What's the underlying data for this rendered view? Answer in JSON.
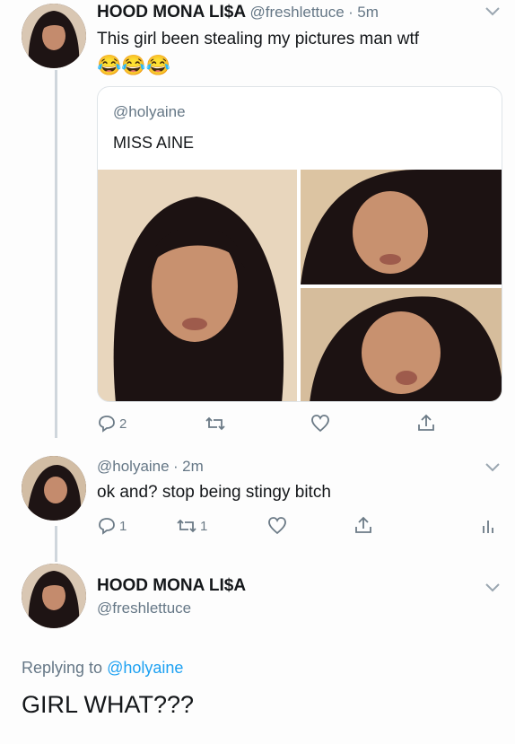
{
  "tweet1": {
    "display_name": "HOOD MONA LI$A",
    "handle": "@freshlettuce",
    "time": "5m",
    "text": "This girl been stealing my pictures man wtf",
    "emoji": "😂😂😂",
    "quote": {
      "handle": "@holyaine",
      "text": "MISS AINE"
    },
    "actions": {
      "reply_count": "2",
      "retweet_count": "",
      "like_count": ""
    }
  },
  "tweet2": {
    "handle": "@holyaine",
    "time": "2m",
    "text": "ok and? stop being stingy bitch",
    "actions": {
      "reply_count": "1",
      "retweet_count": "1",
      "like_count": ""
    }
  },
  "tweet3": {
    "display_name": "HOOD MONA LI$A",
    "handle": "@freshlettuce",
    "replying_prefix": "Replying to",
    "replying_to": "@holyaine",
    "text": "GIRL WHAT???"
  },
  "colors": {
    "link": "#1da1f2",
    "muted": "#657786",
    "thread_line": "#cfd6dc"
  },
  "icons": [
    "reply-icon",
    "retweet-icon",
    "like-icon",
    "share-icon",
    "analytics-icon",
    "chevron-down-icon"
  ]
}
